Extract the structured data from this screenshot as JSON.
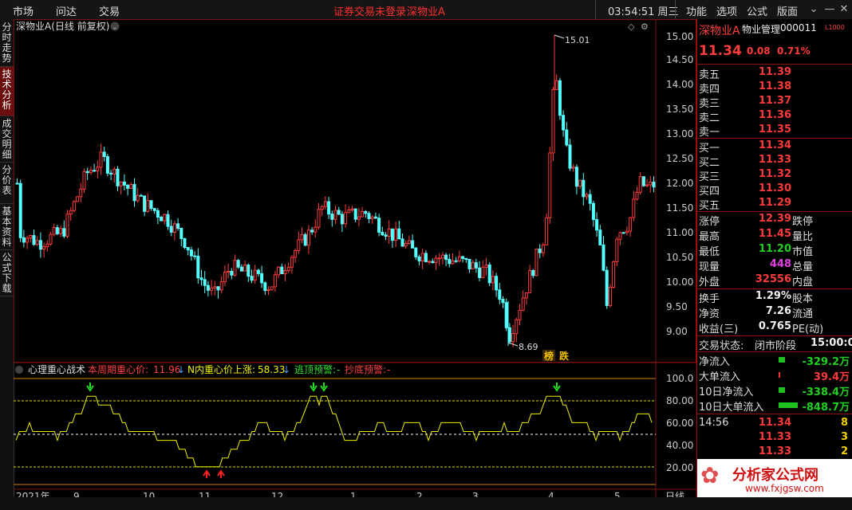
{
  "topbar": {
    "menus": [
      "市场",
      "问达",
      "交易"
    ],
    "notice": "证券交易未登录",
    "stock": "深物业A",
    "clock": "03:54:51 周三",
    "right_menus": [
      "功能",
      "选项",
      "公式",
      "版面"
    ]
  },
  "side_tabs": [
    "分时走势",
    "技术分析",
    "成交明细",
    "分价表",
    "基本资料",
    "公式下载"
  ],
  "chart": {
    "title": "深物业A(日线 前复权)",
    "y_ticks": [
      "15.00",
      "14.50",
      "14.00",
      "13.50",
      "13.00",
      "12.50",
      "12.00",
      "11.50",
      "11.00",
      "10.50",
      "10.00",
      "9.50",
      "9.00"
    ],
    "high_label": "15.01",
    "low_label": "8.69",
    "badge1": "榜",
    "badge2": "跌"
  },
  "indicator": {
    "name": "心理重心战术",
    "f1_label": "本周期重心价:",
    "f1_value": "11.96",
    "f2_label": "N内重心价上涨:",
    "f2_value": "58.33",
    "f3_label": "逃顶预警:",
    "f3_value": "-",
    "f4_label": "抄底预警:",
    "f4_value": "-",
    "y_ticks": [
      "100.0",
      "80.00",
      "60.00",
      "40.00",
      "20.00"
    ]
  },
  "xaxis": {
    "labels": [
      "2021年",
      "9",
      "10",
      "11",
      "12",
      "1",
      "2",
      "3",
      "4",
      "5"
    ],
    "period": "日线"
  },
  "quote": {
    "name": "深物业A",
    "industry": "物业管理",
    "code": "000011",
    "tag": "L1000",
    "price": "11.34",
    "change": "0.08",
    "change_pct": "0.71%",
    "sell": [
      {
        "label": "卖五",
        "price": "11.39"
      },
      {
        "label": "卖四",
        "price": "11.38"
      },
      {
        "label": "卖三",
        "price": "11.37"
      },
      {
        "label": "卖二",
        "price": "11.36"
      },
      {
        "label": "卖一",
        "price": "11.35"
      }
    ],
    "buy": [
      {
        "label": "买一",
        "price": "11.34"
      },
      {
        "label": "买二",
        "price": "11.33"
      },
      {
        "label": "买三",
        "price": "11.32"
      },
      {
        "label": "买四",
        "price": "11.30"
      },
      {
        "label": "买五",
        "price": "11.29"
      }
    ],
    "stats1": [
      {
        "label": "涨停",
        "value": "12.39",
        "right": "跌停",
        "color": "red"
      },
      {
        "label": "最高",
        "value": "11.45",
        "right": "量比",
        "color": "red"
      },
      {
        "label": "最低",
        "value": "11.20",
        "right": "市值",
        "color": "green"
      },
      {
        "label": "现量",
        "value": "448",
        "right": "总量",
        "color": "mag"
      },
      {
        "label": "外盘",
        "value": "32556",
        "right": "内盘",
        "color": "red"
      }
    ],
    "stats2": [
      {
        "label": "换手",
        "value": "1.29%",
        "right": "股本",
        "color": "white"
      },
      {
        "label": "净资",
        "value": "7.26",
        "right": "流通",
        "color": "white"
      },
      {
        "label": "收益(三)",
        "value": "0.765",
        "right": "PE(动)",
        "color": "white"
      }
    ],
    "trade_state_label": "交易状态:",
    "trade_state": "闭市阶段",
    "trade_time": "15:00:0",
    "flows": [
      {
        "label": "净流入",
        "value": "-329.2万",
        "color": "green"
      },
      {
        "label": "大单流入",
        "value": "39.4万",
        "color": "red"
      },
      {
        "label": "10日净流入",
        "value": "-338.4万",
        "color": "green"
      },
      {
        "label": "10日大单流入",
        "value": "-848.7万",
        "color": "green"
      }
    ],
    "ticks": [
      {
        "time": "14:56",
        "price": "11.34",
        "vol": "8"
      },
      {
        "time": "",
        "price": "11.33",
        "vol": "3"
      },
      {
        "time": "",
        "price": "11.33",
        "vol": "2"
      }
    ]
  },
  "watermark": {
    "text": "分析家公式网",
    "url": "www.fxjgsw.com"
  }
}
